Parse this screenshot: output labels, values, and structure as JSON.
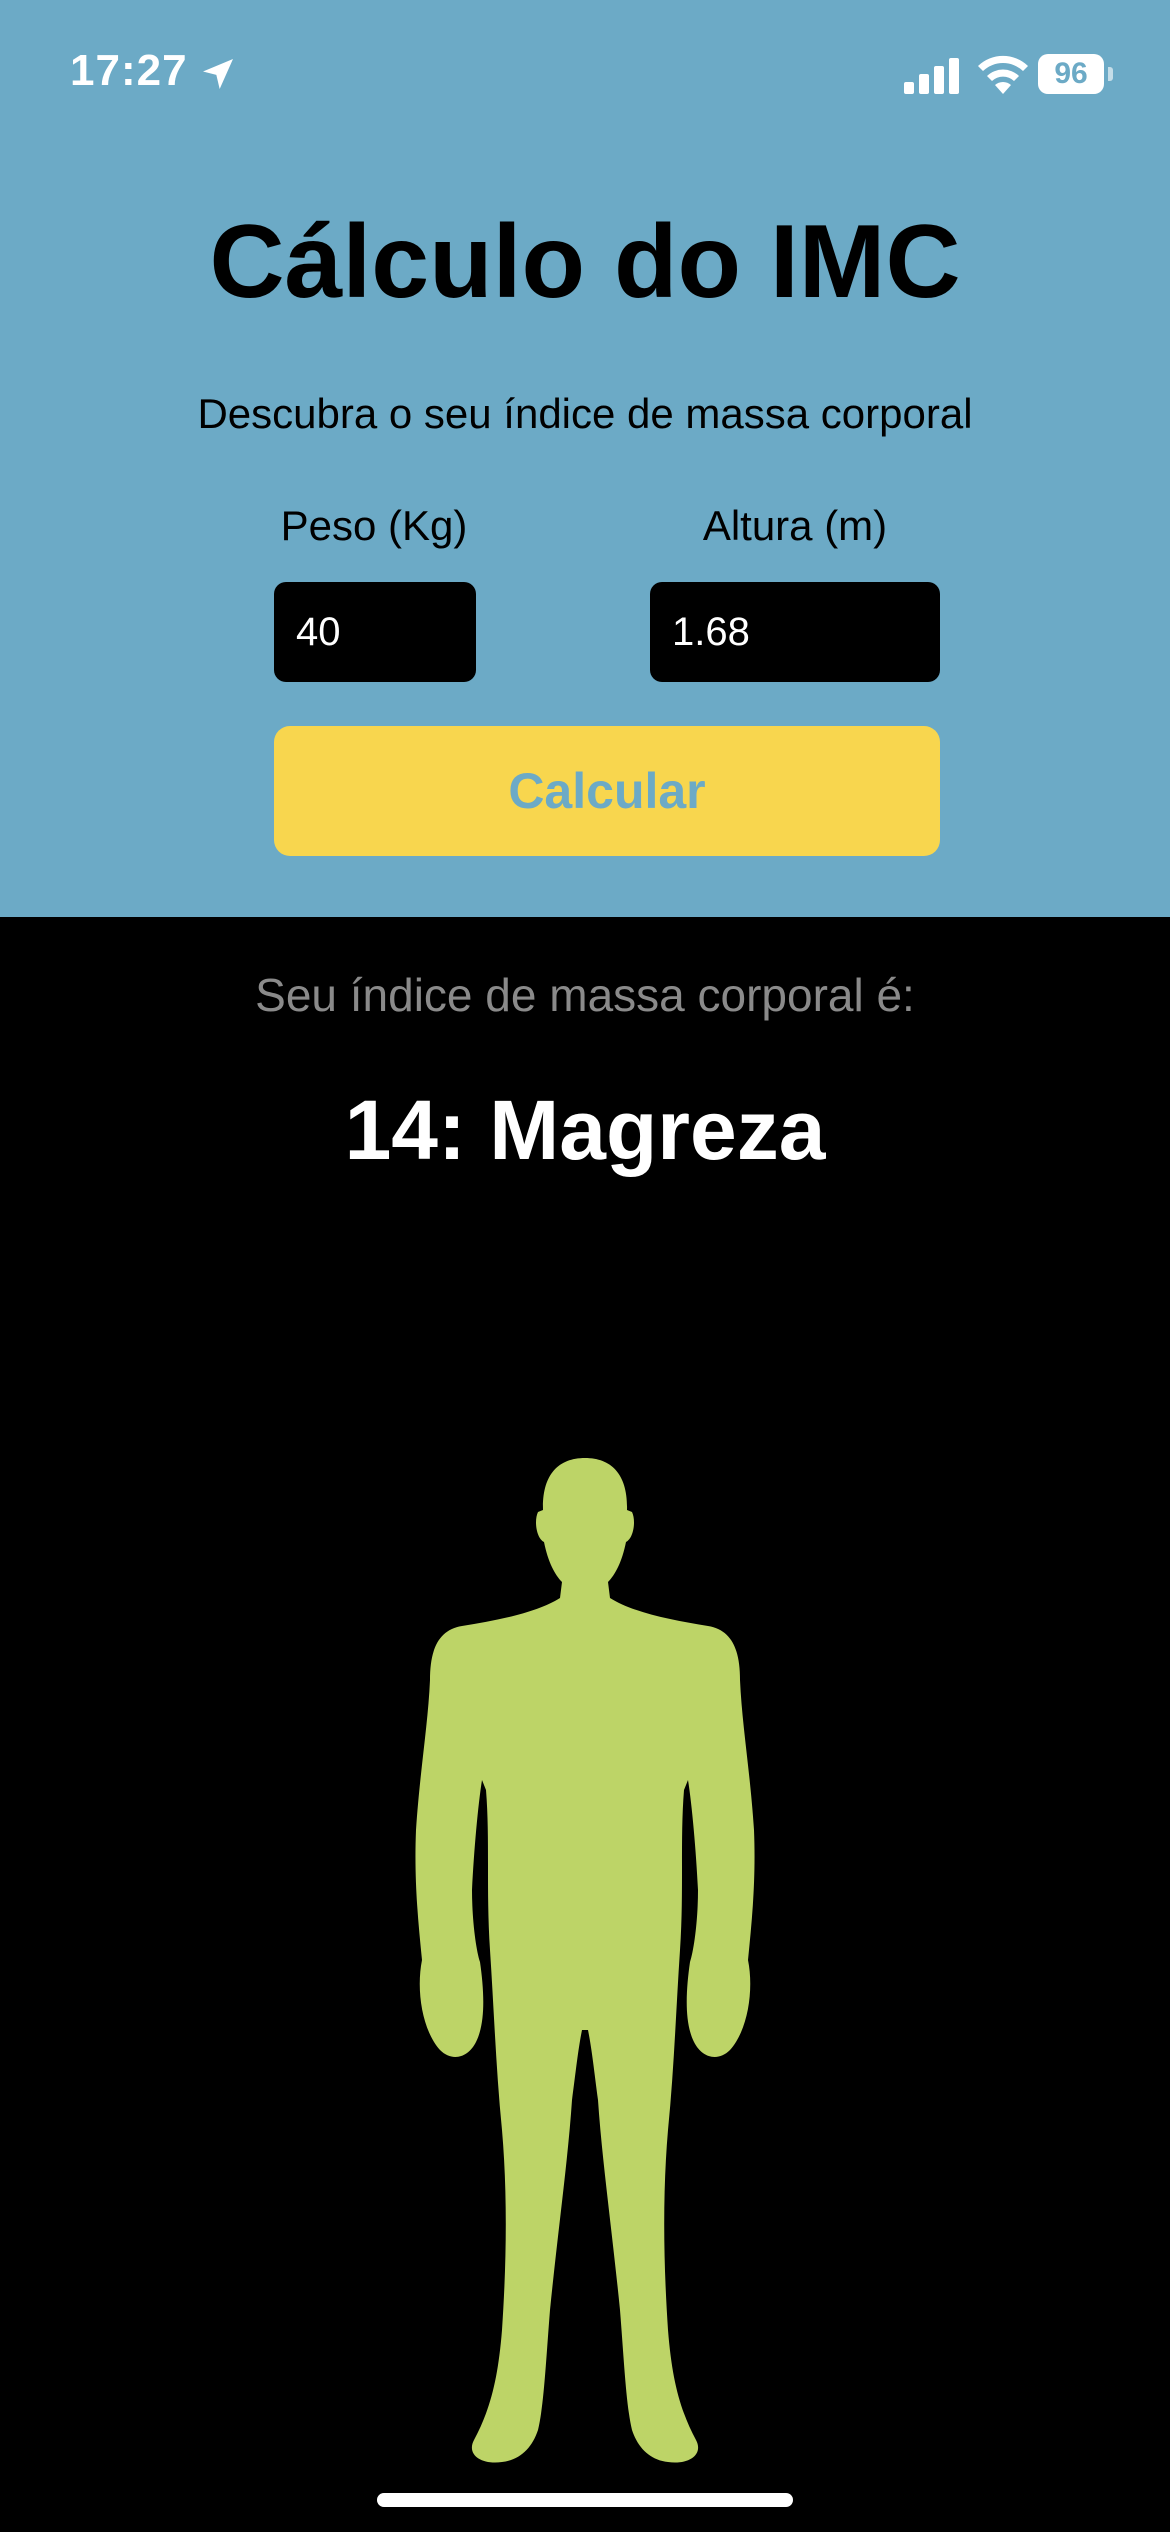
{
  "status_bar": {
    "time": "17:27",
    "battery_level": "96"
  },
  "header": {
    "title": "Cálculo do IMC",
    "subtitle": "Descubra o seu índice de massa corporal"
  },
  "form": {
    "weight_label": "Peso (Kg)",
    "weight_value": "40",
    "height_label": "Altura (m)",
    "height_value": "1.68",
    "calculate_label": "Calcular"
  },
  "result": {
    "caption": "Seu índice de massa corporal é:",
    "value": "14: Magreza"
  },
  "colors": {
    "top_background": "#6CAAC6",
    "bottom_background": "#000000",
    "button": "#F8D64E",
    "figure": "#BDD467"
  },
  "icons": {
    "location": "location-arrow-icon",
    "signal": "cellular-signal-icon",
    "wifi": "wifi-icon",
    "battery": "battery-icon",
    "figure": "body-silhouette-icon"
  }
}
